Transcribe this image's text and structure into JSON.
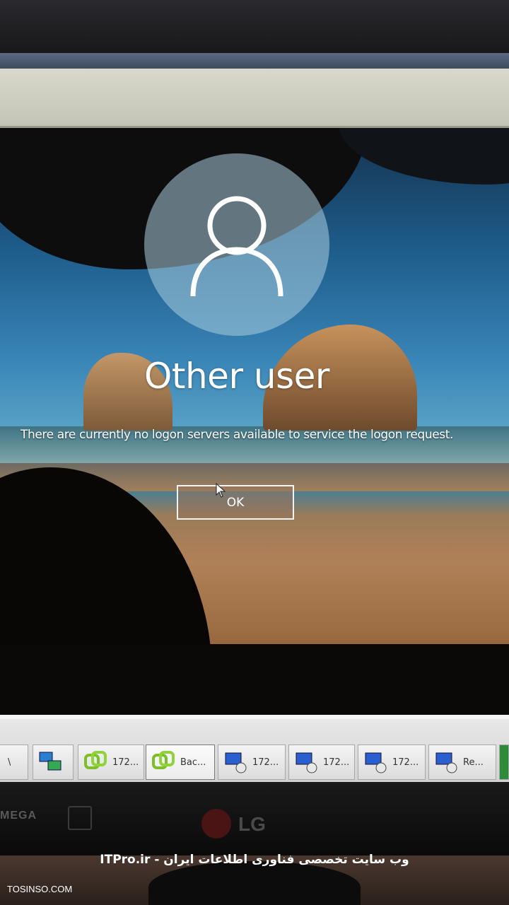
{
  "lock_screen": {
    "username": "Other user",
    "message": "There are currently no logon servers available to service the logon request.",
    "ok_button": "OK",
    "avatar_icon": "user-silhouette-icon"
  },
  "taskbar": {
    "items": [
      {
        "label": "\\",
        "icon": "folder-icon"
      },
      {
        "label": "",
        "icon": "network-computers-icon"
      },
      {
        "label": "172...",
        "icon": "vsphere-icon"
      },
      {
        "label": "Bac...",
        "icon": "vsphere-icon",
        "active": true
      },
      {
        "label": "172...",
        "icon": "remote-desktop-icon"
      },
      {
        "label": "172...",
        "icon": "remote-desktop-icon"
      },
      {
        "label": "172...",
        "icon": "remote-desktop-icon"
      },
      {
        "label": "Re...",
        "icon": "remote-desktop-icon"
      }
    ]
  },
  "monitor": {
    "brand_left": "MEGA",
    "brand": "LG"
  },
  "watermark": {
    "text": "ITPro.ir - وب سایت تخصصی فناوری اطلاعات ایران",
    "credit": "TOSINSO.COM"
  },
  "colors": {
    "ok_border": "#f2f2f2",
    "text": "#ffffff",
    "taskbar_bg": "#e0e0e0"
  }
}
